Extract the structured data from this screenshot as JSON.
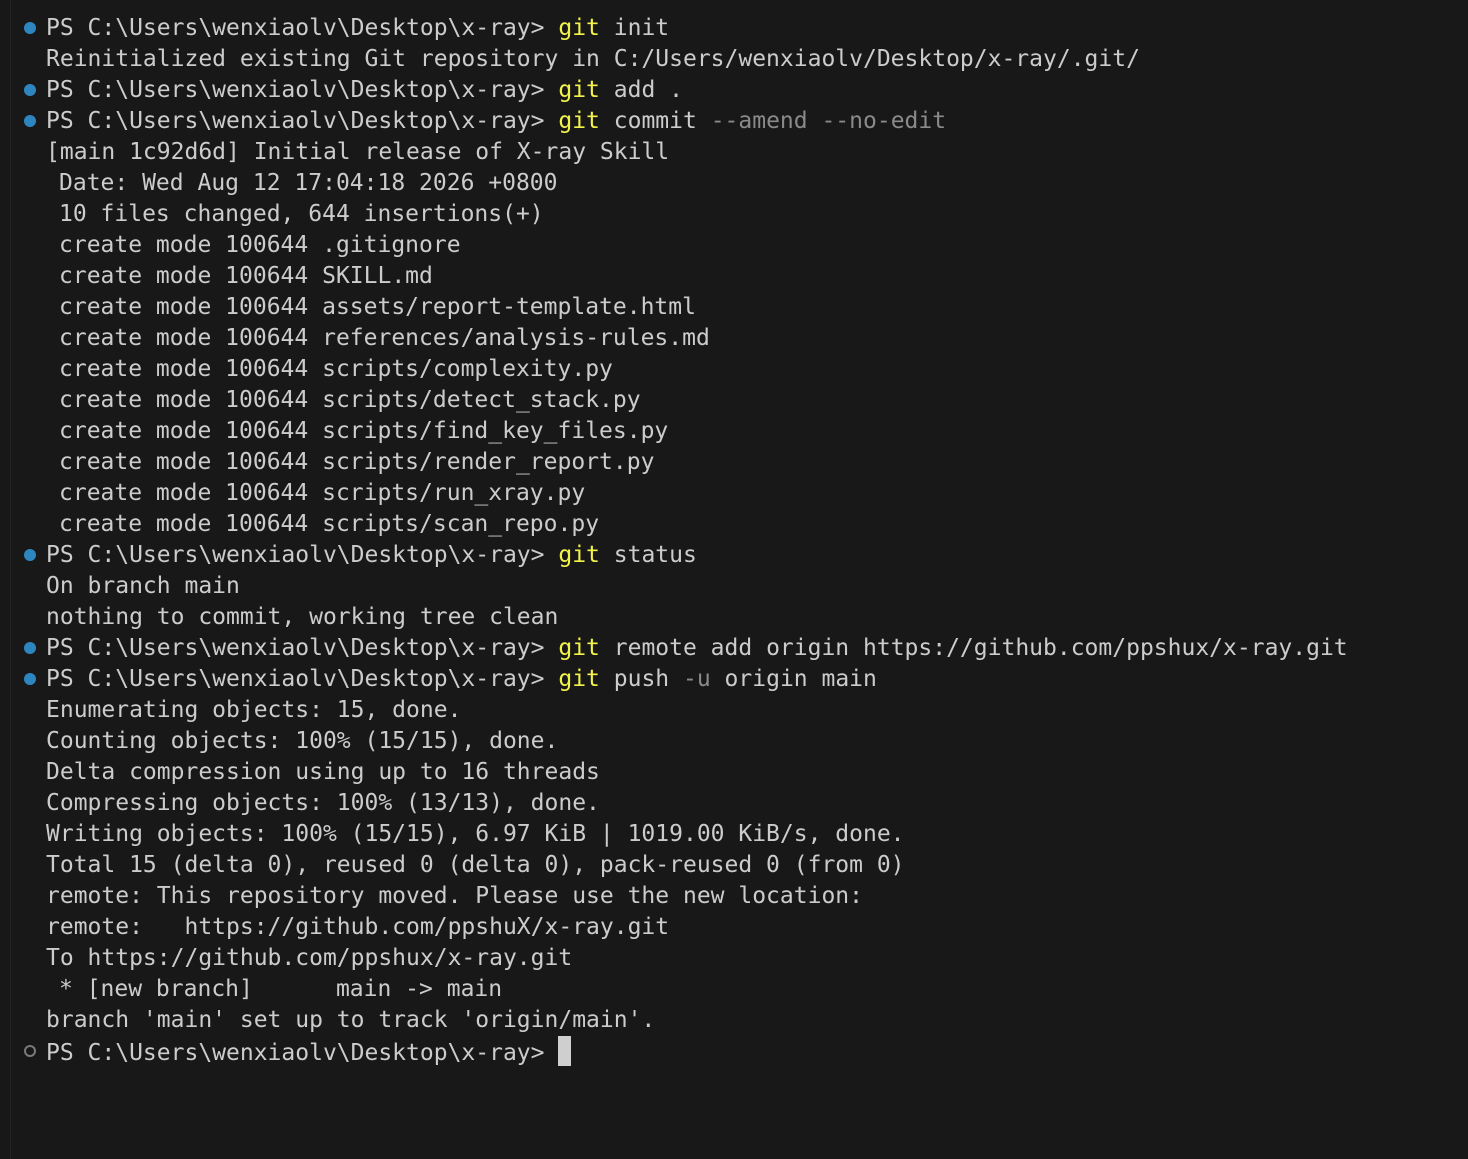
{
  "prompt": "PS C:\\Users\\wenxiaolv\\Desktop\\x-ray> ",
  "commands": [
    {
      "git": "git",
      "args": " init",
      "flags": "",
      "output": [
        "Reinitialized existing Git repository in C:/Users/wenxiaolv/Desktop/x-ray/.git/"
      ]
    },
    {
      "git": "git",
      "args": " add .",
      "flags": "",
      "output": []
    },
    {
      "git": "git",
      "args": " commit ",
      "flags": "--amend --no-edit",
      "output": [
        "[main 1c92d6d] Initial release of X-ray Skill",
        " Date: Wed Aug 12 17:04:18 2026 +0800",
        " 10 files changed, 644 insertions(+)",
        " create mode 100644 .gitignore",
        " create mode 100644 SKILL.md",
        " create mode 100644 assets/report-template.html",
        " create mode 100644 references/analysis-rules.md",
        " create mode 100644 scripts/complexity.py",
        " create mode 100644 scripts/detect_stack.py",
        " create mode 100644 scripts/find_key_files.py",
        " create mode 100644 scripts/render_report.py",
        " create mode 100644 scripts/run_xray.py",
        " create mode 100644 scripts/scan_repo.py"
      ]
    },
    {
      "git": "git",
      "args": " status",
      "flags": "",
      "output": [
        "On branch main",
        "nothing to commit, working tree clean"
      ]
    },
    {
      "git": "git",
      "args": " remote add origin https://github.com/ppshux/x-ray.git",
      "flags": "",
      "output": []
    },
    {
      "git": "git",
      "args": " push ",
      "flags": "-u",
      "args_after": " origin main",
      "output": [
        "Enumerating objects: 15, done.",
        "Counting objects: 100% (15/15), done.",
        "Delta compression using up to 16 threads",
        "Compressing objects: 100% (13/13), done.",
        "Writing objects: 100% (15/15), 6.97 KiB | 1019.00 KiB/s, done.",
        "Total 15 (delta 0), reused 0 (delta 0), pack-reused 0 (from 0)",
        "remote: This repository moved. Please use the new location:",
        "remote:   https://github.com/ppshuX/x-ray.git",
        "To https://github.com/ppshux/x-ray.git",
        " * [new branch]      main -> main",
        "branch 'main' set up to track 'origin/main'."
      ]
    }
  ],
  "final_prompt": "PS C:\\Users\\wenxiaolv\\Desktop\\x-ray> ",
  "colors": {
    "background": "#181818",
    "text": "#cccccc",
    "git_keyword": "#f2f24b",
    "flags": "#8a8a8a",
    "success_mark": "#2e86c1",
    "idle_mark": "#7a7a7a"
  }
}
